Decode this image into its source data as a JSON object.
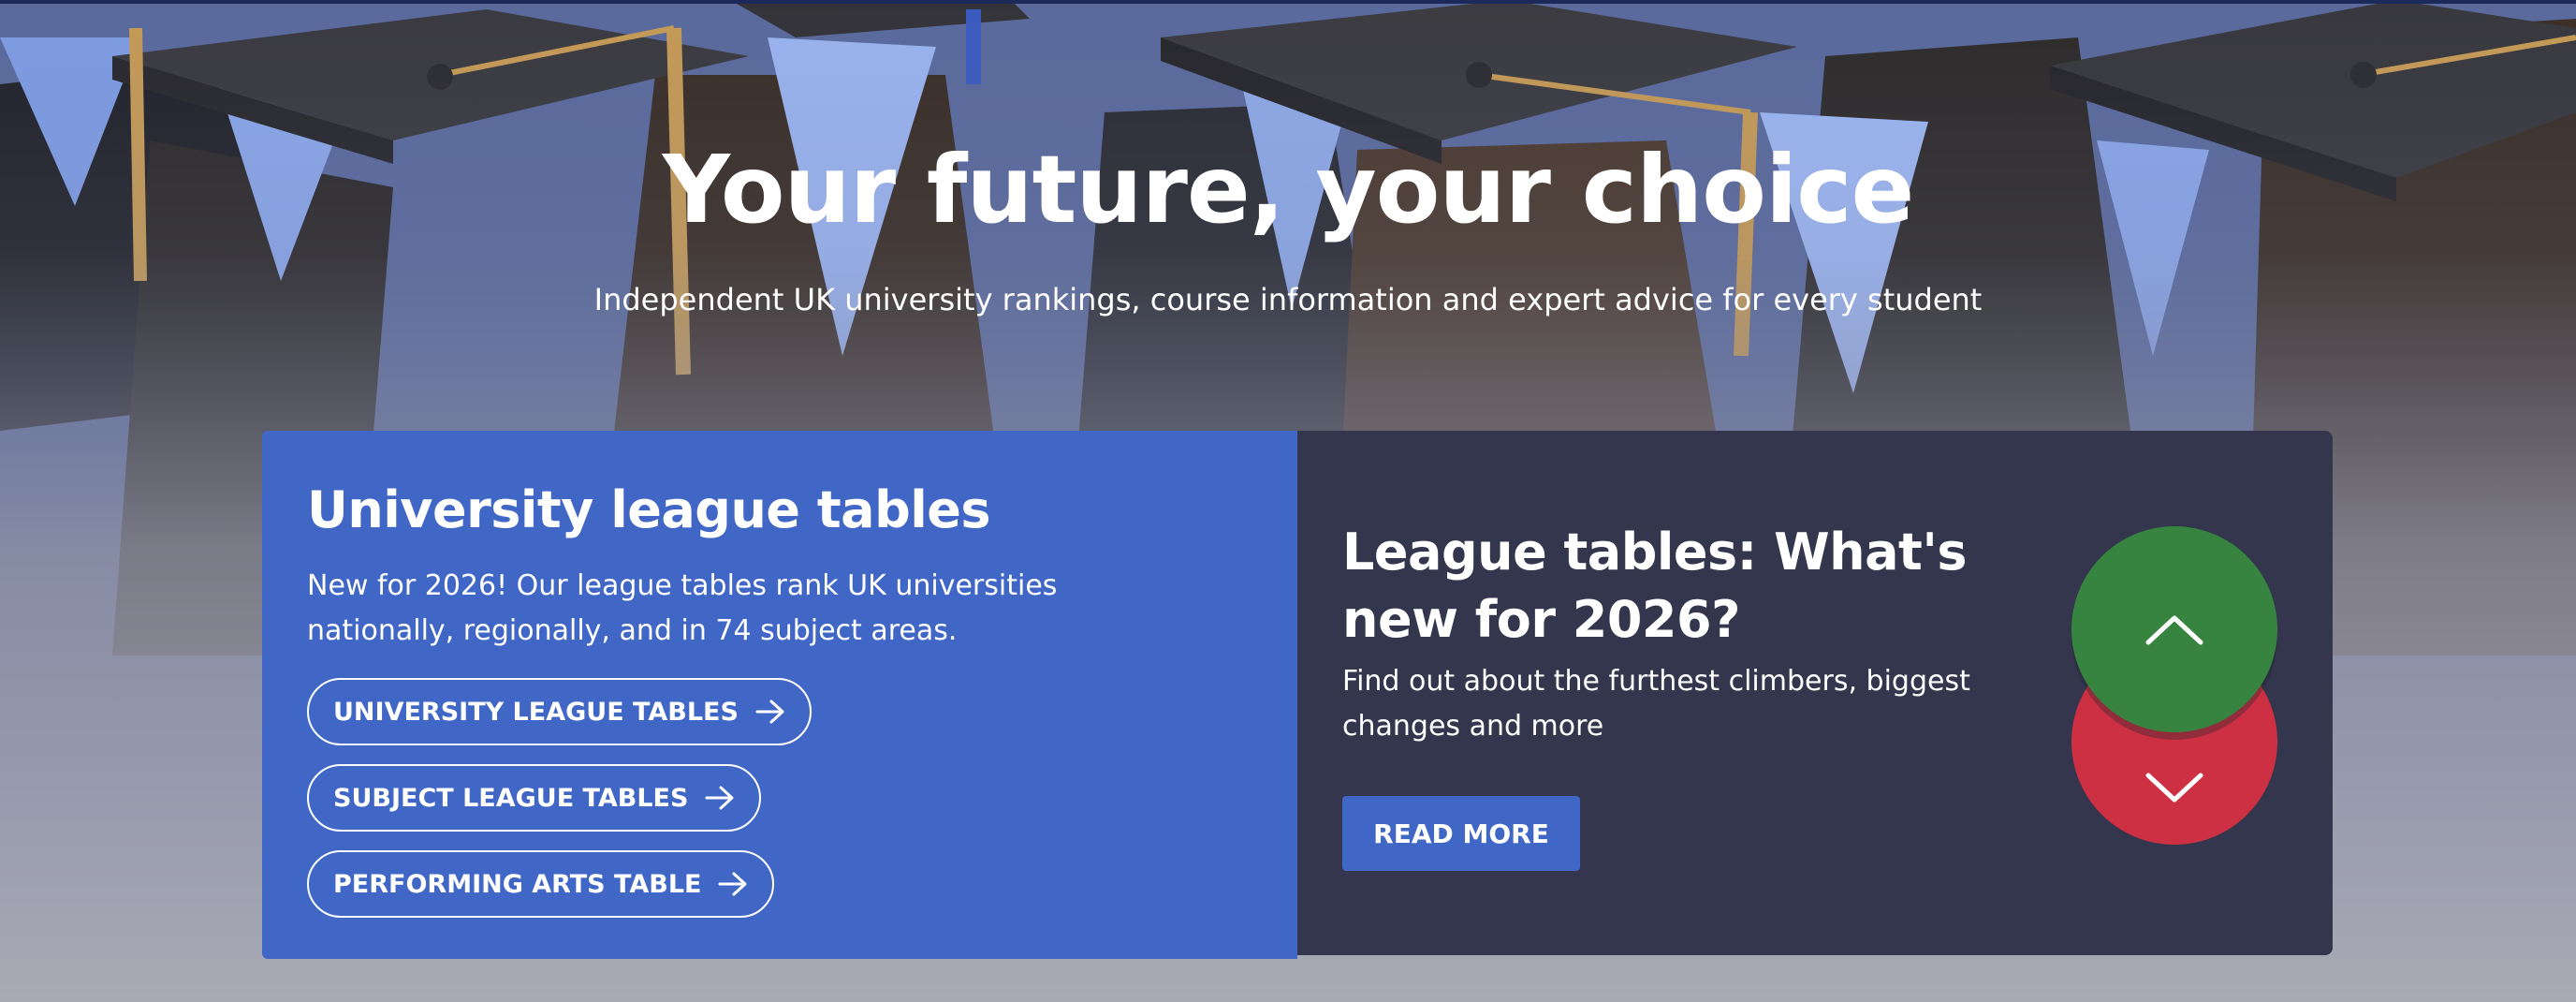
{
  "hero": {
    "title": "Your future, your choice",
    "subtitle": "Independent UK university rankings, course information and expert advice for every student"
  },
  "league_tables_panel": {
    "heading": "University league tables",
    "description": "New for 2026! Our league tables rank UK universities nationally, regionally, and in 74 subject areas.",
    "buttons": [
      {
        "label": "UNIVERSITY LEAGUE TABLES",
        "icon": "arrow-right-icon"
      },
      {
        "label": "SUBJECT LEAGUE TABLES",
        "icon": "arrow-right-icon"
      },
      {
        "label": "PERFORMING ARTS TABLE",
        "icon": "arrow-right-icon"
      }
    ]
  },
  "whats_new_panel": {
    "heading": "League tables: What's new for 2026?",
    "description": "Find out about the furthest climbers, biggest changes and more",
    "button_label": "READ MORE",
    "graphic": {
      "up_icon": "chevron-up-icon",
      "down_icon": "chevron-down-icon"
    }
  },
  "colors": {
    "top_line": "#1b2a5a",
    "primary_blue": "#4066c6",
    "dark_panel": "#33364d",
    "up_green": "#378440",
    "down_red": "#cc3042",
    "text": "#ffffff"
  }
}
